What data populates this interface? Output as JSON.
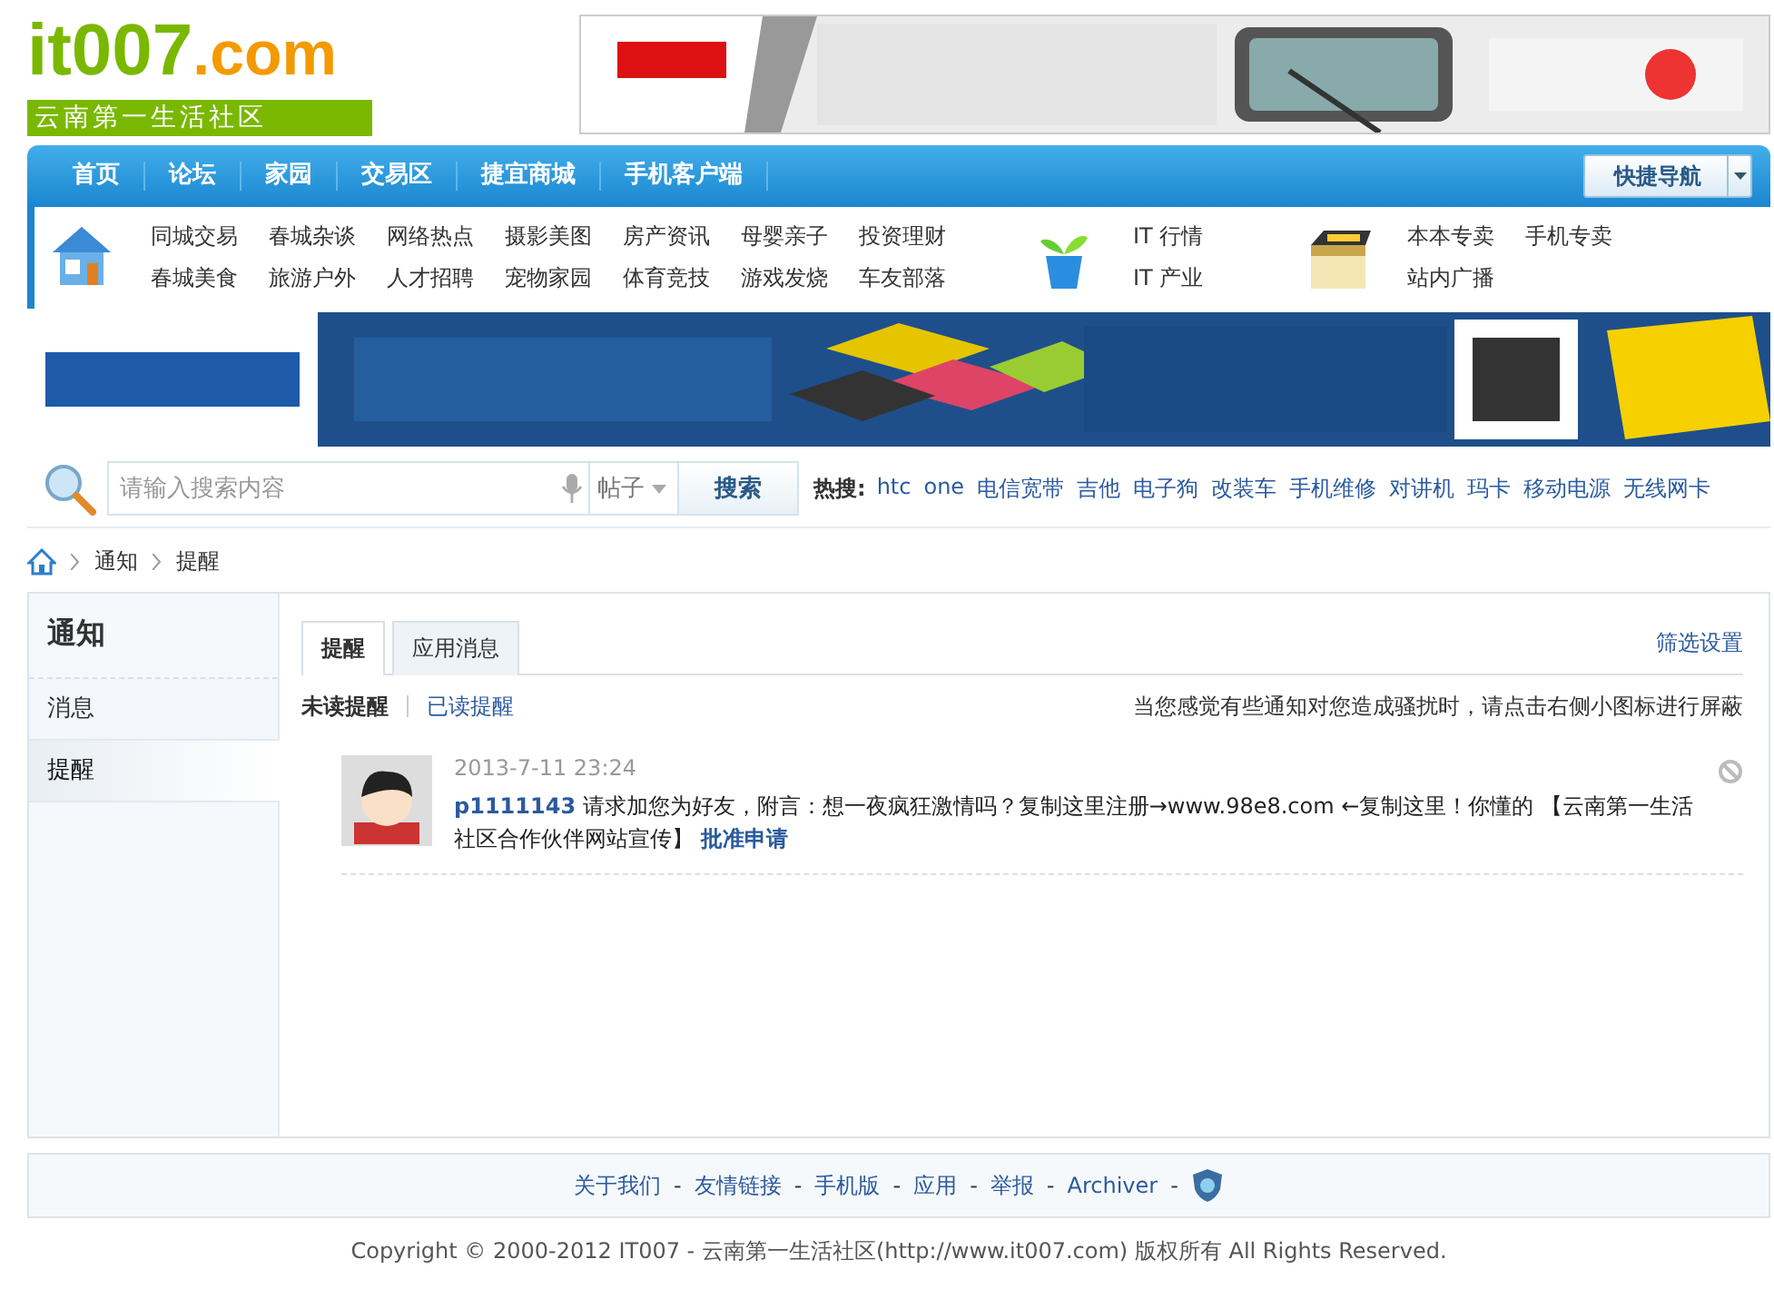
{
  "logo": {
    "brand": "it007",
    "suffix": ".com",
    "slogan": "云南第一生活社区"
  },
  "nav": {
    "items": [
      {
        "label": "首页"
      },
      {
        "label": "论坛"
      },
      {
        "label": "家园"
      },
      {
        "label": "交易区"
      },
      {
        "label": "捷宜商城"
      },
      {
        "label": "手机客户端"
      }
    ],
    "quick_nav": "快捷导航"
  },
  "subnav": {
    "groups": [
      {
        "rows": [
          [
            "同城交易",
            "春城杂谈",
            "网络热点",
            "摄影美图",
            "房产资讯",
            "母婴亲子",
            "投资理财"
          ],
          [
            "春城美食",
            "旅游户外",
            "人才招聘",
            "宠物家园",
            "体育竞技",
            "游戏发烧",
            "车友部落"
          ]
        ]
      },
      {
        "rows": [
          [
            "IT 行情"
          ],
          [
            "IT 产业"
          ]
        ]
      },
      {
        "rows": [
          [
            "本本专卖",
            "手机专卖"
          ],
          [
            "站内广播"
          ]
        ]
      }
    ]
  },
  "search": {
    "placeholder": "请输入搜索内容",
    "scope": "帖子",
    "button": "搜索",
    "hot_label": "热搜:",
    "hot": [
      "htc",
      "one",
      "电信宽带",
      "吉他",
      "电子狗",
      "改装车",
      "手机维修",
      "对讲机",
      "玛卡",
      "移动电源",
      "无线网卡"
    ]
  },
  "breadcrumb": [
    "通知",
    "提醒"
  ],
  "sidebar": {
    "title": "通知",
    "items": [
      {
        "label": "消息",
        "selected": false
      },
      {
        "label": "提醒",
        "selected": true
      }
    ]
  },
  "tabs": [
    {
      "label": "提醒",
      "selected": true
    },
    {
      "label": "应用消息",
      "selected": false
    }
  ],
  "filter_settings": "筛选设置",
  "filters": [
    {
      "label": "未读提醒",
      "selected": true
    },
    {
      "label": "已读提醒",
      "selected": false
    }
  ],
  "hint": "当您感觉有些通知对您造成骚扰时，请点击右侧小图标进行屏蔽",
  "notifications": [
    {
      "time": "2013-7-11 23:24",
      "user": "p1111143",
      "message": "请求加您为好友，附言：想一夜疯狂激情吗？复制这里注册→www.98e8.com ←复制这里！你懂的 【云南第一生活社区合作伙伴网站宣传】",
      "action": "批准申请"
    }
  ],
  "footer": {
    "links": [
      "关于我们",
      "友情链接",
      "手机版",
      "应用",
      "举报",
      "Archiver"
    ],
    "separator": "-",
    "copyright": "Copyright © 2000-2012 IT007 - 云南第一生活社区(http://www.it007.com) 版权所有 All Rights Reserved."
  }
}
